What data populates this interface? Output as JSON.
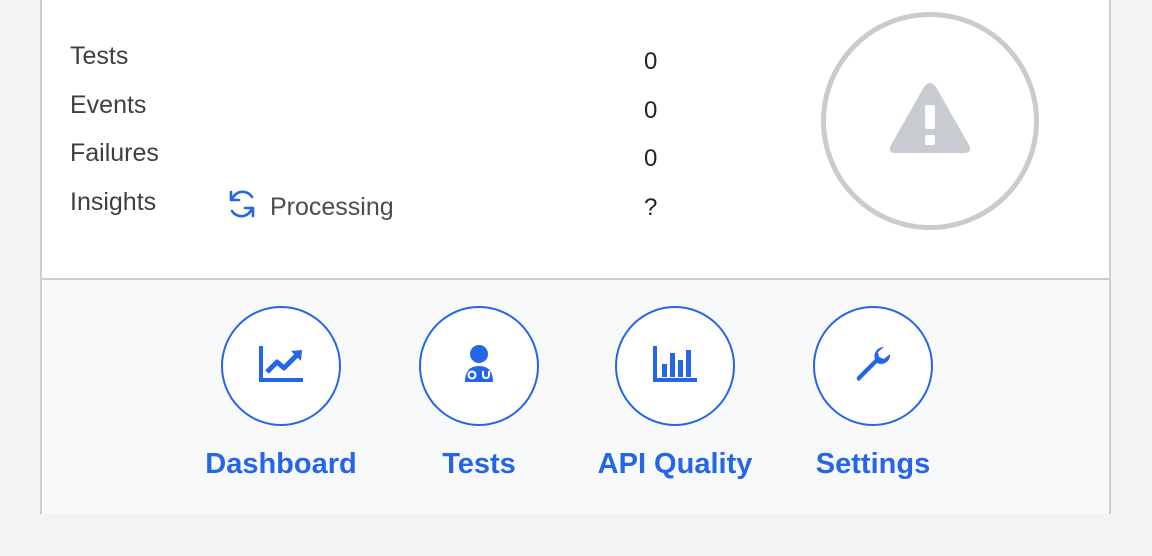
{
  "stats": [
    {
      "label": "Tests",
      "value": "0"
    },
    {
      "label": "Events",
      "value": "0"
    },
    {
      "label": "Failures",
      "value": "0"
    },
    {
      "label": "Insights",
      "value": "?"
    }
  ],
  "insights_status": "Processing",
  "status_icon": "warning-triangle-icon",
  "nav": [
    {
      "label": "Dashboard",
      "icon": "chart-line-icon"
    },
    {
      "label": "Tests",
      "icon": "user-doctor-icon"
    },
    {
      "label": "API Quality",
      "icon": "bar-chart-icon"
    },
    {
      "label": "Settings",
      "icon": "wrench-icon"
    }
  ],
  "colors": {
    "accent": "#2565e8",
    "border": "#c9cfd6",
    "status_gray": "#c8ccd1"
  }
}
